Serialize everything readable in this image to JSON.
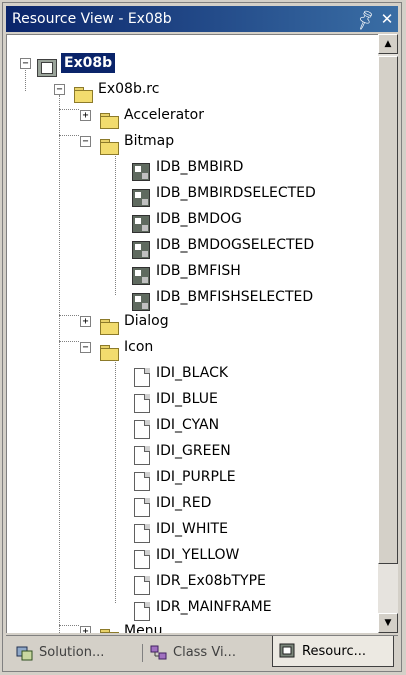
{
  "window": {
    "title": "Resource View - Ex08b",
    "pin_icon": "pin-icon",
    "close_icon": "close-icon"
  },
  "tree": {
    "root": "Ex08b",
    "rc_file": "Ex08b.rc",
    "folders": {
      "accelerator": "Accelerator",
      "bitmap": "Bitmap",
      "dialog": "Dialog",
      "icon": "Icon",
      "menu": "Menu"
    },
    "bitmaps": [
      "IDB_BMBIRD",
      "IDB_BMBIRDSELECTED",
      "IDB_BMDOG",
      "IDB_BMDOGSELECTED",
      "IDB_BMFISH",
      "IDB_BMFISHSELECTED"
    ],
    "icons": [
      "IDI_BLACK",
      "IDI_BLUE",
      "IDI_CYAN",
      "IDI_GREEN",
      "IDI_PURPLE",
      "IDI_RED",
      "IDI_WHITE",
      "IDI_YELLOW",
      "IDR_Ex08bTYPE",
      "IDR_MAINFRAME"
    ],
    "expand_symbol": "+",
    "collapse_symbol": "−"
  },
  "tabs": [
    {
      "label": "Solution...",
      "icon": "solution-explorer-icon"
    },
    {
      "label": "Class Vi...",
      "icon": "class-view-icon"
    },
    {
      "label": "Resourc...",
      "icon": "resource-view-icon"
    }
  ],
  "colors": {
    "title_bar": "#0a246a",
    "selection": "#0a246a",
    "folder": "#f2dc6e"
  }
}
